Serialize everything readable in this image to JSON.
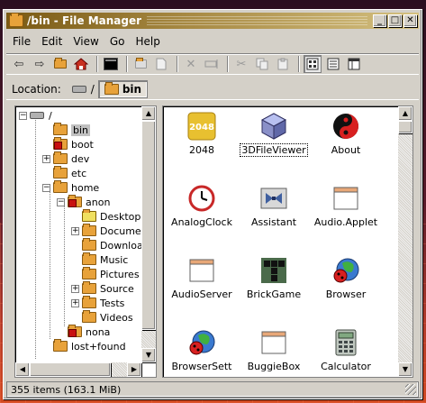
{
  "window": {
    "title": "/bin - File Manager",
    "controls": [
      "_",
      "□",
      "✕"
    ]
  },
  "menu": [
    "File",
    "Edit",
    "View",
    "Go",
    "Help"
  ],
  "location": {
    "label": "Location:",
    "root": "/",
    "current": "bin"
  },
  "tree": {
    "root": "/",
    "items": [
      {
        "label": "bin",
        "depth": 1,
        "expander": "",
        "selected": true
      },
      {
        "label": "boot",
        "depth": 1,
        "expander": "",
        "red": true
      },
      {
        "label": "dev",
        "depth": 1,
        "expander": "+"
      },
      {
        "label": "etc",
        "depth": 1,
        "expander": ""
      },
      {
        "label": "home",
        "depth": 1,
        "expander": "−"
      },
      {
        "label": "anon",
        "depth": 2,
        "expander": "−",
        "red": true
      },
      {
        "label": "Desktop",
        "depth": 3,
        "expander": ""
      },
      {
        "label": "Documen",
        "depth": 3,
        "expander": "+"
      },
      {
        "label": "Downloa",
        "depth": 3,
        "expander": ""
      },
      {
        "label": "Music",
        "depth": 3,
        "expander": ""
      },
      {
        "label": "Pictures",
        "depth": 3,
        "expander": ""
      },
      {
        "label": "Source",
        "depth": 3,
        "expander": "+"
      },
      {
        "label": "Tests",
        "depth": 3,
        "expander": "+"
      },
      {
        "label": "Videos",
        "depth": 3,
        "expander": ""
      },
      {
        "label": "nona",
        "depth": 2,
        "expander": "",
        "red": true
      },
      {
        "label": "lost+found",
        "depth": 1,
        "expander": ""
      }
    ]
  },
  "files": [
    {
      "name": "2048",
      "icon": "2048-icon"
    },
    {
      "name": "3DFileViewer",
      "icon": "cube-icon",
      "focused": true
    },
    {
      "name": "About",
      "icon": "serenity-logo-icon"
    },
    {
      "name": "AnalogClock",
      "icon": "clock-icon"
    },
    {
      "name": "Assistant",
      "icon": "bowtie-icon"
    },
    {
      "name": "Audio.Applet",
      "icon": "window-icon"
    },
    {
      "name": "AudioServer",
      "icon": "window-icon"
    },
    {
      "name": "BrickGame",
      "icon": "bricks-icon"
    },
    {
      "name": "Browser",
      "icon": "globe-bug-icon"
    },
    {
      "name": "BrowserSett",
      "icon": "globe-bug-icon"
    },
    {
      "name": "BuggieBox",
      "icon": "window-icon"
    },
    {
      "name": "Calculator",
      "icon": "calculator-icon"
    }
  ],
  "status": {
    "text": "355 items (163.1 MiB)"
  },
  "colors": {
    "title_start": "#7a5a14",
    "title_end": "#d4c080",
    "folder": "#e8a23a",
    "face": "#d4d0c8"
  }
}
